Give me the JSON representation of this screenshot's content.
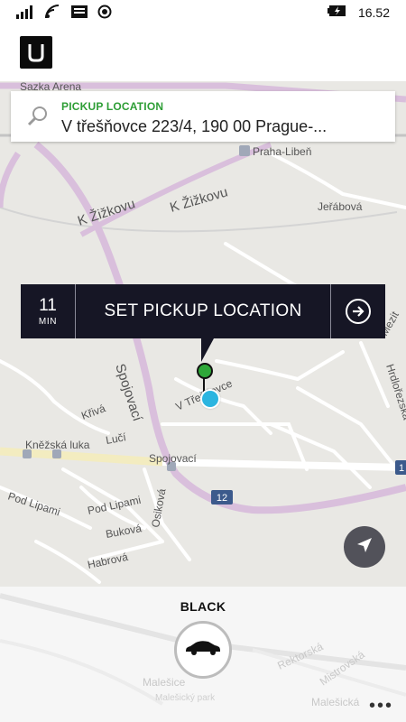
{
  "status_bar": {
    "time": "16.52"
  },
  "search": {
    "label": "PICKUP LOCATION",
    "address": "V třešňovce 223/4, 190 00 Prague-..."
  },
  "pickup": {
    "eta_value": "11",
    "eta_unit": "MIN",
    "button_label": "SET PICKUP LOCATION"
  },
  "map": {
    "labels": {
      "sazka_arena": "Sazka Arena",
      "praha_liben": "Praha-Libeň",
      "jerabova": "Jeřábová",
      "k_zizkovu_1": "K Žižkovu",
      "k_zizkovu_2": "K Žižkovu",
      "spojovaci_road": "Spojovací",
      "spojovaci_stop": "Spojovací",
      "v_tresnovce": "V Třešňovce",
      "kriva": "Křivá",
      "luci": "Lučí",
      "knezska_luka": "Kněžská luka",
      "pod_lipami_1": "Pod Lipami",
      "pod_lipami_2": "Pod Lipami",
      "bukova": "Buková",
      "osikova": "Osiková",
      "habrova": "Habrová",
      "hrdlorezska": "Hrdlořezská",
      "mezit": "Mezit",
      "road_12": "12",
      "num_1": "1"
    }
  },
  "vehicle": {
    "type": "BLACK"
  },
  "bottom_map": {
    "labels": {
      "malesice": "Malešice",
      "rektorska": "Rektorská",
      "mistrovska": "Mistrovská",
      "malesicky_park": "Malešický park",
      "malesicka": "Malešická"
    }
  },
  "more_label": "•••",
  "colors": {
    "accent_green": "#2e9e36",
    "bar_bg": "#161625",
    "location_blue": "#2cb5e0",
    "highway_purple": "#d9bfdc"
  }
}
